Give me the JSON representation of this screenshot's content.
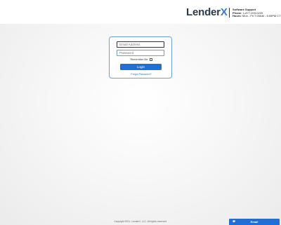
{
  "header": {
    "logo_main": "Lender",
    "logo_accent": "X",
    "support": {
      "title": "Software Support",
      "phone_label": "Phone:",
      "phone_value": "1-877-203-0220",
      "hours_label": "Hours:",
      "hours_value": "Mon - Fri 7:00AM - 6:00PM CT"
    }
  },
  "login": {
    "email_placeholder": "Email Address",
    "password_placeholder": "Password",
    "remember_label": "Remember Me",
    "login_button": "Login",
    "forgot_link": "Forgot Password?"
  },
  "footer": {
    "copyright": "Copyright 2021, LenderX, LLC. All rights reserved."
  },
  "email_widget": {
    "label": "Email",
    "icon": "chat-bubble-icon"
  }
}
